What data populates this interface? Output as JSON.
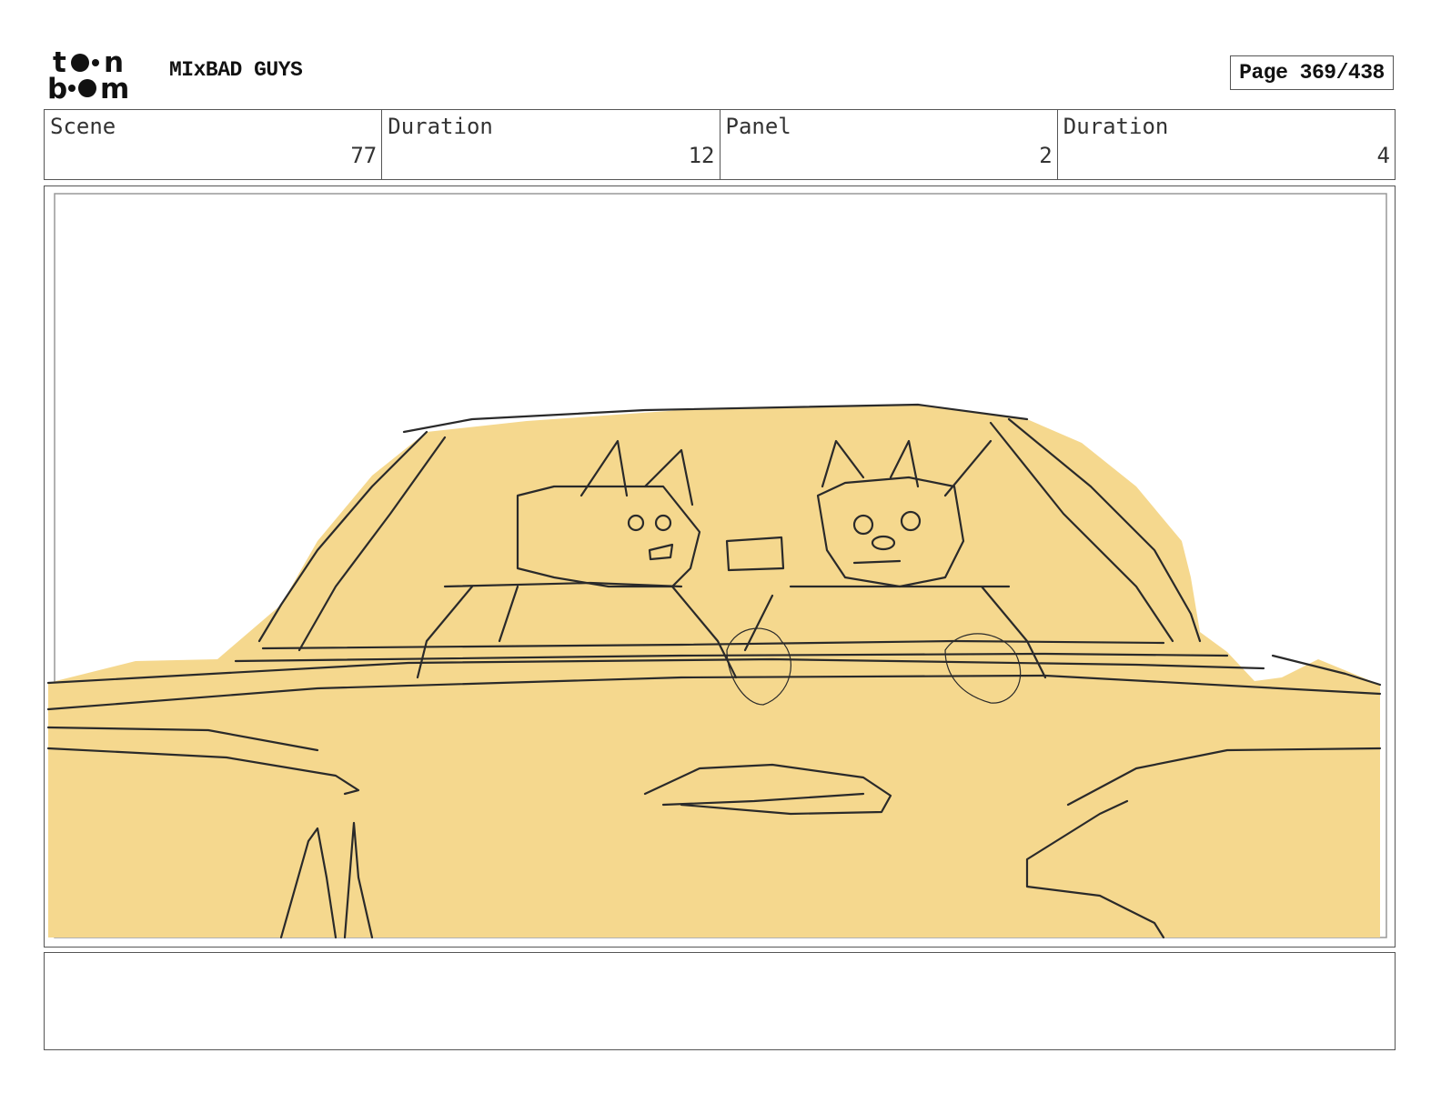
{
  "header": {
    "logo_top": "to•n",
    "logo_bottom": "b••m",
    "project_title": "MIxBAD GUYS",
    "page_label": "Page 369/438"
  },
  "info": {
    "scene_label": "Scene",
    "scene_value": "77",
    "scene_duration_label": "Duration",
    "scene_duration_value": "12",
    "panel_label": "Panel",
    "panel_value": "2",
    "panel_duration_label": "Duration",
    "panel_duration_value": "4"
  },
  "panel": {
    "fill_color": "#f5d88e",
    "line_color": "#2a2a2a"
  },
  "notes": {
    "text": ""
  }
}
